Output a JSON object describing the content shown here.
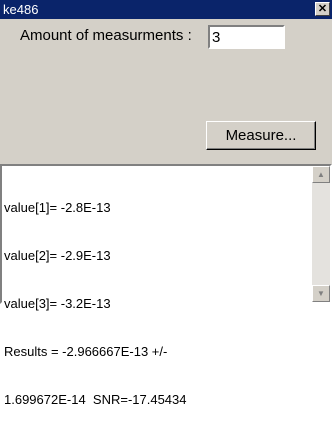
{
  "window": {
    "title": "ke486",
    "close_glyph": "✕"
  },
  "form": {
    "amount_label": "Amount of measurments :",
    "amount_value": "3",
    "measure_label": "Measure..."
  },
  "output": {
    "lines": [
      "value[1]= -2.8E-13",
      "value[2]= -2.9E-13",
      "value[3]= -3.2E-13",
      "Results = -2.966667E-13 +/-",
      "1.699672E-14  SNR=-17.45434"
    ]
  },
  "scrollbar": {
    "up_glyph": "▲",
    "down_glyph": "▼"
  }
}
